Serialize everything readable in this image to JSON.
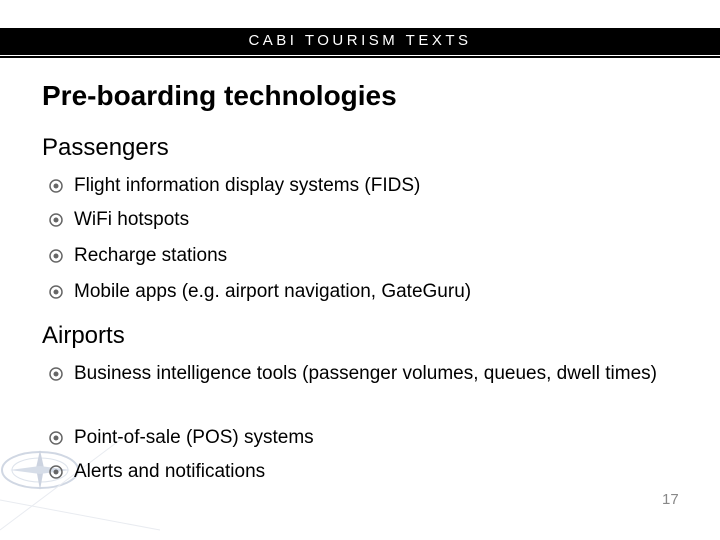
{
  "header": {
    "title": "CABI TOURISM TEXTS"
  },
  "slide": {
    "title": "Pre-boarding technologies",
    "sections": [
      {
        "heading": "Passengers",
        "bullets": [
          "Flight information display systems (FIDS)",
          "WiFi hotspots",
          "Recharge stations",
          "Mobile apps (e.g. airport navigation, GateGuru)"
        ]
      },
      {
        "heading": "Airports",
        "bullets": [
          "Business intelligence tools (passenger volumes, queues, dwell times)",
          "Point-of-sale (POS) systems",
          "Alerts and notifications"
        ]
      }
    ],
    "bullet_icon": "circled-dot-icon",
    "page_number": "17"
  },
  "colors": {
    "header_bg": "#000000",
    "header_text": "#ffffff",
    "bullet_icon": "#666666",
    "page_number": "#888888"
  }
}
